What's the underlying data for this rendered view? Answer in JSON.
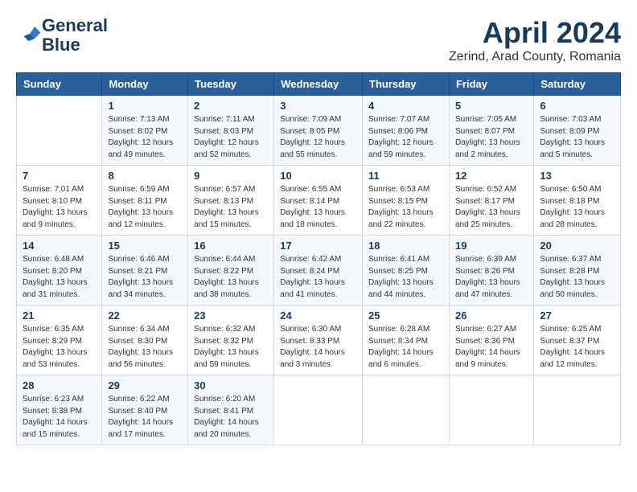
{
  "header": {
    "logo_line1": "General",
    "logo_line2": "Blue",
    "month_year": "April 2024",
    "location": "Zerind, Arad County, Romania"
  },
  "weekdays": [
    "Sunday",
    "Monday",
    "Tuesday",
    "Wednesday",
    "Thursday",
    "Friday",
    "Saturday"
  ],
  "weeks": [
    [
      {
        "day": "",
        "sunrise": "",
        "sunset": "",
        "daylight": ""
      },
      {
        "day": "1",
        "sunrise": "Sunrise: 7:13 AM",
        "sunset": "Sunset: 8:02 PM",
        "daylight": "Daylight: 12 hours and 49 minutes."
      },
      {
        "day": "2",
        "sunrise": "Sunrise: 7:11 AM",
        "sunset": "Sunset: 8:03 PM",
        "daylight": "Daylight: 12 hours and 52 minutes."
      },
      {
        "day": "3",
        "sunrise": "Sunrise: 7:09 AM",
        "sunset": "Sunset: 8:05 PM",
        "daylight": "Daylight: 12 hours and 55 minutes."
      },
      {
        "day": "4",
        "sunrise": "Sunrise: 7:07 AM",
        "sunset": "Sunset: 8:06 PM",
        "daylight": "Daylight: 12 hours and 59 minutes."
      },
      {
        "day": "5",
        "sunrise": "Sunrise: 7:05 AM",
        "sunset": "Sunset: 8:07 PM",
        "daylight": "Daylight: 13 hours and 2 minutes."
      },
      {
        "day": "6",
        "sunrise": "Sunrise: 7:03 AM",
        "sunset": "Sunset: 8:09 PM",
        "daylight": "Daylight: 13 hours and 5 minutes."
      }
    ],
    [
      {
        "day": "7",
        "sunrise": "Sunrise: 7:01 AM",
        "sunset": "Sunset: 8:10 PM",
        "daylight": "Daylight: 13 hours and 9 minutes."
      },
      {
        "day": "8",
        "sunrise": "Sunrise: 6:59 AM",
        "sunset": "Sunset: 8:11 PM",
        "daylight": "Daylight: 13 hours and 12 minutes."
      },
      {
        "day": "9",
        "sunrise": "Sunrise: 6:57 AM",
        "sunset": "Sunset: 8:13 PM",
        "daylight": "Daylight: 13 hours and 15 minutes."
      },
      {
        "day": "10",
        "sunrise": "Sunrise: 6:55 AM",
        "sunset": "Sunset: 8:14 PM",
        "daylight": "Daylight: 13 hours and 18 minutes."
      },
      {
        "day": "11",
        "sunrise": "Sunrise: 6:53 AM",
        "sunset": "Sunset: 8:15 PM",
        "daylight": "Daylight: 13 hours and 22 minutes."
      },
      {
        "day": "12",
        "sunrise": "Sunrise: 6:52 AM",
        "sunset": "Sunset: 8:17 PM",
        "daylight": "Daylight: 13 hours and 25 minutes."
      },
      {
        "day": "13",
        "sunrise": "Sunrise: 6:50 AM",
        "sunset": "Sunset: 8:18 PM",
        "daylight": "Daylight: 13 hours and 28 minutes."
      }
    ],
    [
      {
        "day": "14",
        "sunrise": "Sunrise: 6:48 AM",
        "sunset": "Sunset: 8:20 PM",
        "daylight": "Daylight: 13 hours and 31 minutes."
      },
      {
        "day": "15",
        "sunrise": "Sunrise: 6:46 AM",
        "sunset": "Sunset: 8:21 PM",
        "daylight": "Daylight: 13 hours and 34 minutes."
      },
      {
        "day": "16",
        "sunrise": "Sunrise: 6:44 AM",
        "sunset": "Sunset: 8:22 PM",
        "daylight": "Daylight: 13 hours and 38 minutes."
      },
      {
        "day": "17",
        "sunrise": "Sunrise: 6:42 AM",
        "sunset": "Sunset: 8:24 PM",
        "daylight": "Daylight: 13 hours and 41 minutes."
      },
      {
        "day": "18",
        "sunrise": "Sunrise: 6:41 AM",
        "sunset": "Sunset: 8:25 PM",
        "daylight": "Daylight: 13 hours and 44 minutes."
      },
      {
        "day": "19",
        "sunrise": "Sunrise: 6:39 AM",
        "sunset": "Sunset: 8:26 PM",
        "daylight": "Daylight: 13 hours and 47 minutes."
      },
      {
        "day": "20",
        "sunrise": "Sunrise: 6:37 AM",
        "sunset": "Sunset: 8:28 PM",
        "daylight": "Daylight: 13 hours and 50 minutes."
      }
    ],
    [
      {
        "day": "21",
        "sunrise": "Sunrise: 6:35 AM",
        "sunset": "Sunset: 8:29 PM",
        "daylight": "Daylight: 13 hours and 53 minutes."
      },
      {
        "day": "22",
        "sunrise": "Sunrise: 6:34 AM",
        "sunset": "Sunset: 8:30 PM",
        "daylight": "Daylight: 13 hours and 56 minutes."
      },
      {
        "day": "23",
        "sunrise": "Sunrise: 6:32 AM",
        "sunset": "Sunset: 8:32 PM",
        "daylight": "Daylight: 13 hours and 59 minutes."
      },
      {
        "day": "24",
        "sunrise": "Sunrise: 6:30 AM",
        "sunset": "Sunset: 8:33 PM",
        "daylight": "Daylight: 14 hours and 3 minutes."
      },
      {
        "day": "25",
        "sunrise": "Sunrise: 6:28 AM",
        "sunset": "Sunset: 8:34 PM",
        "daylight": "Daylight: 14 hours and 6 minutes."
      },
      {
        "day": "26",
        "sunrise": "Sunrise: 6:27 AM",
        "sunset": "Sunset: 8:36 PM",
        "daylight": "Daylight: 14 hours and 9 minutes."
      },
      {
        "day": "27",
        "sunrise": "Sunrise: 6:25 AM",
        "sunset": "Sunset: 8:37 PM",
        "daylight": "Daylight: 14 hours and 12 minutes."
      }
    ],
    [
      {
        "day": "28",
        "sunrise": "Sunrise: 6:23 AM",
        "sunset": "Sunset: 8:38 PM",
        "daylight": "Daylight: 14 hours and 15 minutes."
      },
      {
        "day": "29",
        "sunrise": "Sunrise: 6:22 AM",
        "sunset": "Sunset: 8:40 PM",
        "daylight": "Daylight: 14 hours and 17 minutes."
      },
      {
        "day": "30",
        "sunrise": "Sunrise: 6:20 AM",
        "sunset": "Sunset: 8:41 PM",
        "daylight": "Daylight: 14 hours and 20 minutes."
      },
      {
        "day": "",
        "sunrise": "",
        "sunset": "",
        "daylight": ""
      },
      {
        "day": "",
        "sunrise": "",
        "sunset": "",
        "daylight": ""
      },
      {
        "day": "",
        "sunrise": "",
        "sunset": "",
        "daylight": ""
      },
      {
        "day": "",
        "sunrise": "",
        "sunset": "",
        "daylight": ""
      }
    ]
  ]
}
